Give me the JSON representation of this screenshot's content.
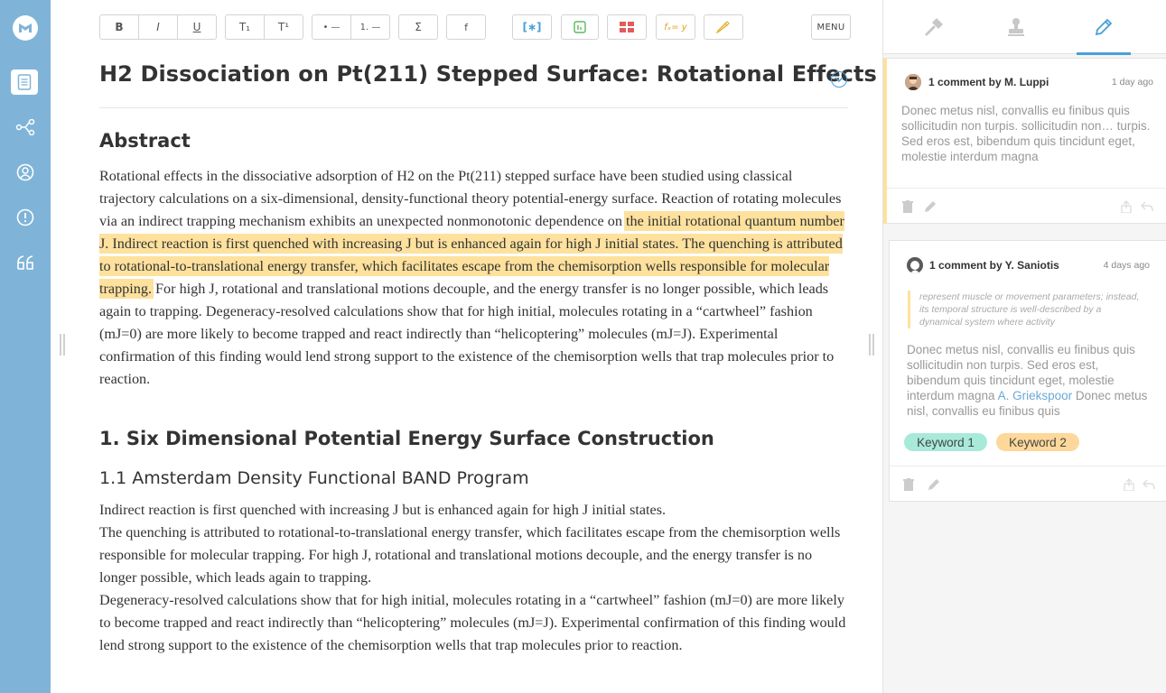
{
  "rail": {
    "items": [
      {
        "icon": "logo-icon"
      },
      {
        "icon": "document-icon",
        "active": true
      },
      {
        "icon": "share-nodes-icon"
      },
      {
        "icon": "user-circle-icon"
      },
      {
        "icon": "alert-circle-icon"
      },
      {
        "icon": "quote-icon"
      }
    ]
  },
  "toolbar": {
    "bold": "B",
    "italic": "I",
    "underline": "U",
    "subscript": "T₁",
    "superscript": "T¹",
    "bullet_list": "• —",
    "numbered_list": "1. —",
    "sum": "Σ",
    "function": "f",
    "citation": "[∗]",
    "figure": "figure-icon",
    "table": "table-icon",
    "equation": "fₓ= y",
    "highlight": "highlighter-icon",
    "menu": "MENU"
  },
  "document": {
    "title": "H2 Dissociation on Pt(211) Stepped Surface: Rotational Effects",
    "abstract_heading": "Abstract",
    "abstract_before": "Rotational effects in the dissociative adsorption of H2 on the Pt(211) stepped surface have been studied using classical trajectory calculations on a six-dimensional, density-functional theory potential-energy surface. Reaction of rotating molecules via an indirect trapping mechanism exhibits an unexpected nonmonotonic dependence on ",
    "abstract_highlight": "the initial rotational quantum number J. Indirect reaction is first quenched with increasing J but is enhanced again for high J initial states. The quenching is attributed to rotational-to-translational energy transfer, which facilitates escape from the chemisorption wells responsible for molecular trapping.",
    "abstract_after": " For high J, rotational and translational motions decouple, and the energy transfer is no longer possible, which leads again to trapping. Degeneracy-resolved calculations show that for high initial, molecules rotating in a “cartwheel” fashion (mJ=0) are more likely to become trapped and react indirectly than “helicoptering” molecules (mJ=J). Experimental confirmation of this finding would lend strong support to the existence of the chemisorption wells that trap molecules prior to reaction.",
    "section1_heading": "1. Six Dimensional Potential Energy Surface Construction",
    "section11_heading": "1.1 Amsterdam Density Functional BAND Program",
    "section11_p1": "Indirect reaction is first quenched with increasing J but is enhanced again for high J initial states.",
    "section11_p2": "The quenching is attributed to rotational-to-translational energy transfer, which facilitates escape from the chemisorption wells responsible for molecular trapping. For high J, rotational and translational motions decouple, and the energy transfer is no longer possible, which leads again to trapping.",
    "section11_p3": "Degeneracy-resolved calculations show that for high initial, molecules rotating in a “cartwheel” fashion (mJ=0) are more likely to become trapped and react indirectly than “helicoptering” molecules (mJ=J). Experimental confirmation of this finding would lend strong support to the existence of the chemisorption wells that trap molecules prior to reaction."
  },
  "panel": {
    "tabs": [
      {
        "icon": "hammer-icon"
      },
      {
        "icon": "stamp-icon"
      },
      {
        "icon": "pencil-icon",
        "active": true
      }
    ],
    "comments": [
      {
        "author": "1 comment by M. Luppi",
        "time": "1 day ago",
        "body": "Donec metus nisl, convallis eu finibus quis sollicitudin non turpis. sollicitudin non… turpis. Sed eros est, bibendum quis tincidunt eget, molestie interdum magna"
      },
      {
        "author": "1 comment by Y. Saniotis",
        "time": "4 days ago",
        "quote": "represent muscle or movement parameters; instead, its temporal structure is well-described by a dynamical system where activity",
        "body_before": "Donec metus nisl, convallis eu finibus quis sollicitudin non turpis. Sed eros est, bibendum quis tincidunt eget, molestie interdum magna ",
        "mention": "A. Griekspoor",
        "body_after": " Donec metus nisl, convallis eu finibus quis",
        "keywords": [
          {
            "label": "Keyword  1",
            "color": "#a8ead9"
          },
          {
            "label": "Keyword  2",
            "color": "#fdd89a"
          }
        ]
      }
    ]
  },
  "colors": {
    "rail": "#7fb4d8",
    "accent": "#4a9fd6",
    "highlight": "#fde19d"
  }
}
